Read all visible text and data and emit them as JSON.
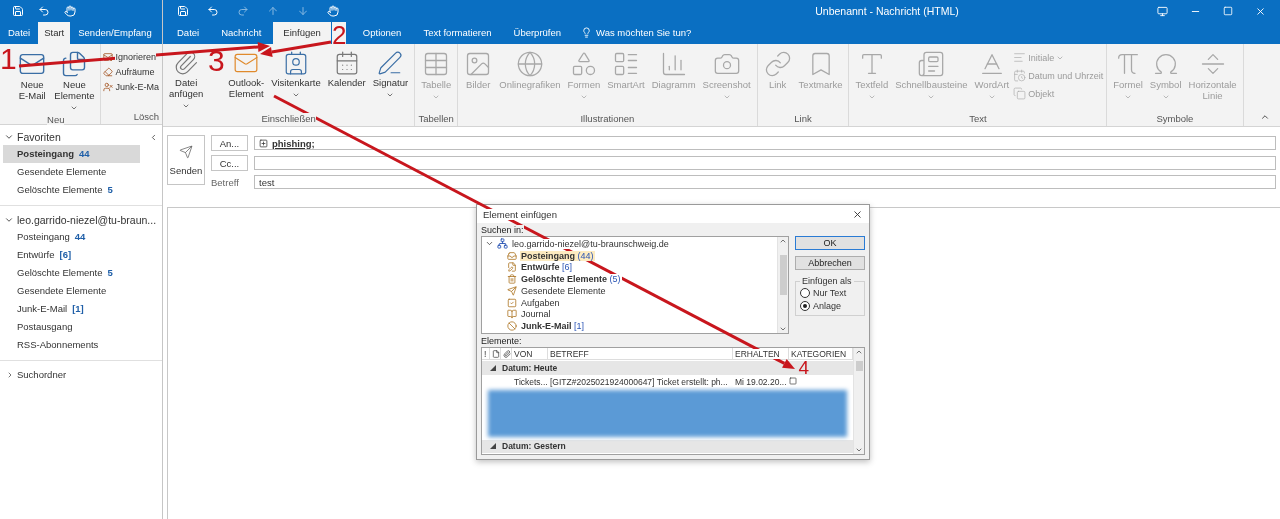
{
  "main_window": {
    "tabs": [
      {
        "label": "Datei",
        "selected": false
      },
      {
        "label": "Start",
        "selected": true
      },
      {
        "label": "Senden/Empfang",
        "selected": false
      }
    ],
    "ribbon": {
      "large_buttons": [
        {
          "label": "Neue E-Mail",
          "dropdown": false
        },
        {
          "label": "Neue Elemente",
          "dropdown": true
        }
      ],
      "small_buttons": [
        "Ignorieren",
        "Aufräume",
        "Junk-E-Ma"
      ],
      "group_labels": [
        "Neu",
        "Lösch"
      ]
    },
    "sidebar": {
      "sections": [
        {
          "title": "Favoriten",
          "expanded": true,
          "items": [
            {
              "label": "Posteingang",
              "count": "44",
              "selected": true
            },
            {
              "label": "Gesendete Elemente",
              "selected": false
            },
            {
              "label": "Gelöschte Elemente",
              "count": "5",
              "selected": false
            }
          ]
        },
        {
          "title": "leo.garrido-niezel@tu-braun...",
          "expanded": true,
          "items": [
            {
              "label": "Posteingang",
              "count": "44",
              "selected": false
            },
            {
              "label": "Entwürfe",
              "count": "[6]",
              "selected": false
            },
            {
              "label": "Gelöschte Elemente",
              "count": "5",
              "selected": false
            },
            {
              "label": "Gesendete Elemente",
              "selected": false
            },
            {
              "label": "Junk-E-Mail",
              "count": "[1]",
              "selected": false
            },
            {
              "label": "Postausgang",
              "selected": false
            },
            {
              "label": "RSS-Abonnements",
              "selected": false
            }
          ]
        }
      ],
      "search_folders": {
        "label": "Suchordner",
        "expanded": false
      }
    }
  },
  "compose": {
    "title": "Unbenannt - Nachricht (HTML)",
    "tabs": [
      {
        "label": "Datei",
        "selected": false
      },
      {
        "label": "Nachricht",
        "selected": false
      },
      {
        "label": "Einfügen",
        "selected": true
      },
      {
        "label": "Optionen",
        "selected": false
      },
      {
        "label": "Text formatieren",
        "selected": false
      },
      {
        "label": "Überprüfen",
        "selected": false
      }
    ],
    "tell_me": "Was möchten Sie tun?",
    "ribbon_groups": [
      {
        "label": "Einschließen",
        "buttons": [
          {
            "label": "Datei anfügen",
            "dropdown": true,
            "disabled": false
          },
          {
            "label": "Outlook-Element",
            "dropdown": false,
            "disabled": false
          },
          {
            "label": "Visitenkarte",
            "dropdown": true,
            "disabled": false
          },
          {
            "label": "Kalender",
            "dropdown": false,
            "disabled": false
          },
          {
            "label": "Signatur",
            "dropdown": true,
            "disabled": false
          }
        ]
      },
      {
        "label": "Tabellen",
        "buttons": [
          {
            "label": "Tabelle",
            "dropdown": true,
            "disabled": true
          }
        ]
      },
      {
        "label": "Illustrationen",
        "buttons": [
          {
            "label": "Bilder",
            "dropdown": false,
            "disabled": true
          },
          {
            "label": "Onlinegrafiken",
            "dropdown": false,
            "disabled": true
          },
          {
            "label": "Formen",
            "dropdown": true,
            "disabled": true
          },
          {
            "label": "SmartArt",
            "dropdown": false,
            "disabled": true
          },
          {
            "label": "Diagramm",
            "dropdown": false,
            "disabled": true
          },
          {
            "label": "Screenshot",
            "dropdown": true,
            "disabled": true
          }
        ]
      },
      {
        "label": "Link",
        "buttons": [
          {
            "label": "Link",
            "dropdown": false,
            "disabled": true
          },
          {
            "label": "Textmarke",
            "dropdown": false,
            "disabled": true
          }
        ]
      },
      {
        "label": "Text",
        "buttons": [
          {
            "label": "Textfeld",
            "dropdown": true,
            "disabled": true
          },
          {
            "label": "Schnellbausteine",
            "dropdown": true,
            "disabled": true
          },
          {
            "label": "WordArt",
            "dropdown": true,
            "disabled": true
          }
        ],
        "small_buttons": [
          {
            "label": "Initiale",
            "dropdown": true,
            "disabled": true
          },
          {
            "label": "Datum und Uhrzeit",
            "dropdown": false,
            "disabled": true
          },
          {
            "label": "Objekt",
            "dropdown": false,
            "disabled": true
          }
        ]
      },
      {
        "label": "Symbole",
        "buttons": [
          {
            "label": "Formel",
            "dropdown": true,
            "disabled": true
          },
          {
            "label": "Symbol",
            "dropdown": true,
            "disabled": true
          },
          {
            "label": "Horizontale Linie",
            "dropdown": false,
            "disabled": true
          }
        ]
      }
    ],
    "header": {
      "send_button": "Senden",
      "to_button": "An...",
      "cc_button": "Cc...",
      "subject_label": "Betreff",
      "to_value": "phishing;",
      "subject_value": "test"
    },
    "dialog": {
      "title": "Element einfügen",
      "search_label": "Suchen in:",
      "tree": {
        "label": "leo.garrido-niezel@tu-braunschweig.de",
        "expanded": true,
        "children": [
          {
            "label": "Posteingang",
            "count": "(44)",
            "unread": true,
            "selected": true
          },
          {
            "label": "Entwürfe",
            "count": "[6]",
            "unread": true,
            "selected": false
          },
          {
            "label": "Gelöschte Elemente",
            "count": "(5)",
            "unread": true,
            "selected": false
          },
          {
            "label": "Gesendete Elemente",
            "unread": false,
            "selected": false
          },
          {
            "label": "Aufgaben",
            "unread": false,
            "selected": false
          },
          {
            "label": "Journal",
            "unread": false,
            "selected": false
          },
          {
            "label": "Junk-E-Mail",
            "count": "[1]",
            "unread": true,
            "selected": false
          }
        ]
      },
      "buttons": [
        "OK",
        "Abbrechen"
      ],
      "insert_as": {
        "label": "Einfügen als",
        "options": [
          {
            "label": "Nur Text",
            "selected": false
          },
          {
            "label": "Anlage",
            "selected": true
          }
        ]
      },
      "items_label": "Elemente:",
      "columns": [
        {
          "kind": "text",
          "label": "!"
        },
        {
          "kind": "icon"
        },
        {
          "kind": "icon"
        },
        {
          "kind": "text",
          "label": "VON"
        },
        {
          "kind": "text",
          "label": "BETREFF"
        },
        {
          "kind": "text",
          "label": "ERHALTEN"
        },
        {
          "kind": "text",
          "label": "KATEGORIEN"
        }
      ],
      "groups": [
        {
          "label": "Datum: Heute",
          "expanded": true,
          "rows": [
            {
              "from": "Tickets...",
              "subject": "[GITZ#2025021924000647] Ticket erstellt: ph...",
              "received": "Mi 19.02.20..."
            }
          ]
        },
        {
          "label": "Datum: Gestern",
          "expanded": true
        }
      ]
    }
  },
  "annotations": [
    {
      "label": "1"
    },
    {
      "label": "2"
    },
    {
      "label": "3"
    },
    {
      "label": "4"
    }
  ]
}
